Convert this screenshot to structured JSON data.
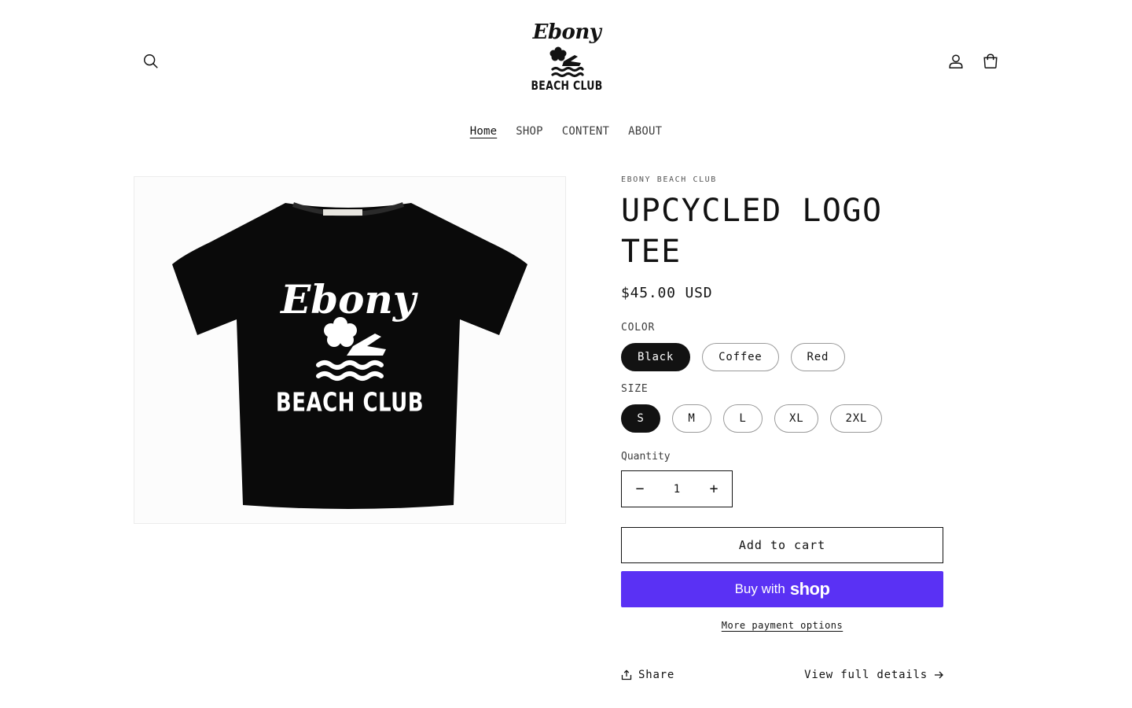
{
  "header": {
    "logo": {
      "script": "Ebony",
      "sub": "BEACH CLUB"
    },
    "icons": {
      "search": "search-icon",
      "account": "account-icon",
      "cart": "cart-icon"
    }
  },
  "nav": [
    {
      "label": "Home",
      "active": true
    },
    {
      "label": "SHOP",
      "active": false
    },
    {
      "label": "CONTENT",
      "active": false
    },
    {
      "label": "ABOUT",
      "active": false
    }
  ],
  "product": {
    "vendor": "EBONY BEACH CLUB",
    "title": "UPCYCLED LOGO TEE",
    "price": "$45.00 USD",
    "image": {
      "shirt_script": "Ebony",
      "shirt_sub": "BEACH CLUB"
    },
    "color": {
      "label": "COLOR",
      "options": [
        "Black",
        "Coffee",
        "Red"
      ],
      "selected": "Black"
    },
    "size": {
      "label": "SIZE",
      "options": [
        "S",
        "M",
        "L",
        "XL",
        "2XL"
      ],
      "selected": "S"
    },
    "quantity": {
      "label": "Quantity",
      "value": "1",
      "decrease": "−",
      "increase": "+"
    }
  },
  "actions": {
    "add_to_cart": "Add to cart",
    "buy_with": "Buy with",
    "buy_brand": "shop",
    "more_payment": "More payment options",
    "share": "Share",
    "view_details": "View full details"
  },
  "colors": {
    "accent": "#5a31f4",
    "selected": "#121212"
  }
}
